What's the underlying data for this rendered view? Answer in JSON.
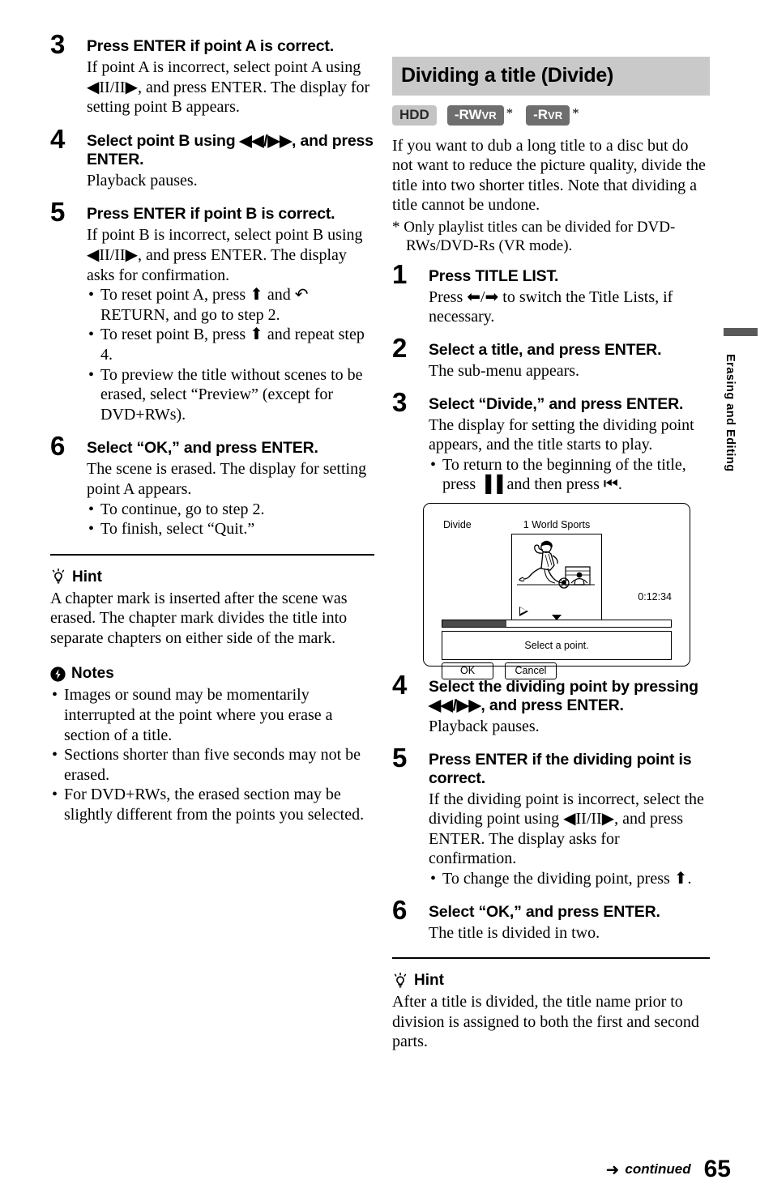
{
  "page_number": "65",
  "footer": {
    "arrow": "➜",
    "continued": "continued"
  },
  "side_tab": {
    "label": "Erasing and Editing"
  },
  "left_column": {
    "steps": [
      {
        "num": "3",
        "head": "Press ENTER if point A is correct.",
        "body": "If point A is incorrect, select point A using ◀II/II▶, and press ENTER. The display for setting point B appears."
      },
      {
        "num": "4",
        "head": "Select point B using ◀◀/▶▶, and press ENTER.",
        "body": "Playback pauses."
      },
      {
        "num": "5",
        "head": "Press ENTER if point B is correct.",
        "body": "If point B is incorrect, select point B using ◀II/II▶, and press ENTER. The display asks for confirmation.",
        "bullets": [
          "To reset point A, press ⬆ and ↶ RETURN, and go to step 2.",
          "To reset point B, press ⬆ and repeat step 4.",
          "To preview the title without scenes to be erased, select “Preview” (except for DVD+RWs)."
        ]
      },
      {
        "num": "6",
        "head": "Select “OK,” and press ENTER.",
        "body": "The scene is erased. The display for setting point A appears.",
        "bullets": [
          "To continue, go to step 2.",
          "To finish, select “Quit.”"
        ]
      }
    ],
    "hint": {
      "title": "Hint",
      "body": "A chapter mark is inserted after the scene was erased. The chapter mark divides the title into separate chapters on either side of the mark."
    },
    "notes": {
      "title": "Notes",
      "items": [
        "Images or sound may be momentarily interrupted at the point where you erase a section of a title.",
        "Sections shorter than five seconds may not be erased.",
        "For DVD+RWs, the erased section may be slightly different from the points you selected."
      ]
    }
  },
  "right_column": {
    "section_title": "Dividing a title (Divide)",
    "badges": [
      {
        "main": "HDD",
        "sub": "",
        "style": "light",
        "asterisk": false
      },
      {
        "main": "-RW",
        "sub": "VR",
        "style": "dark",
        "asterisk": true
      },
      {
        "main": "-R",
        "sub": "VR",
        "style": "dark",
        "asterisk": true
      }
    ],
    "intro": "If you want to dub a long title to a disc but do not want to reduce the picture quality, divide the title into two shorter titles. Note that dividing a title cannot be undone.",
    "footnote": "* Only playlist titles can be divided for DVD-RWs/DVD-Rs (VR mode).",
    "steps": [
      {
        "num": "1",
        "head": "Press TITLE LIST.",
        "body": "Press ⬅/➡ to switch the Title Lists, if necessary."
      },
      {
        "num": "2",
        "head": "Select a title, and press ENTER.",
        "body": "The sub-menu appears."
      },
      {
        "num": "3",
        "head": "Select “Divide,” and press ENTER.",
        "body": "The display for setting the dividing point appears, and the title starts to play.",
        "bullets": [
          "To return to the beginning of the title, press ▐▐ and then press ⏮."
        ]
      },
      {
        "num": "4",
        "head": "Select the dividing point by pressing ◀◀/▶▶, and press ENTER.",
        "body": "Playback pauses."
      },
      {
        "num": "5",
        "head": "Press ENTER if the dividing point is correct.",
        "body": "If the dividing point is incorrect, select the dividing point using ◀II/II▶, and press ENTER. The display asks for confirmation.",
        "bullets": [
          "To change the dividing point, press ⬆."
        ]
      },
      {
        "num": "6",
        "head": "Select “OK,” and press ENTER.",
        "body": "The title is divided in two."
      }
    ],
    "screen": {
      "mode_label": "Divide",
      "title_text": "1 World Sports",
      "timecode": "0:12:34",
      "message": "Select a point.",
      "ok_button": "OK",
      "cancel_button": "Cancel",
      "progress_percent": 28
    },
    "hint": {
      "title": "Hint",
      "body": "After a title is divided, the title name prior to division is assigned to both the first and second parts."
    }
  }
}
